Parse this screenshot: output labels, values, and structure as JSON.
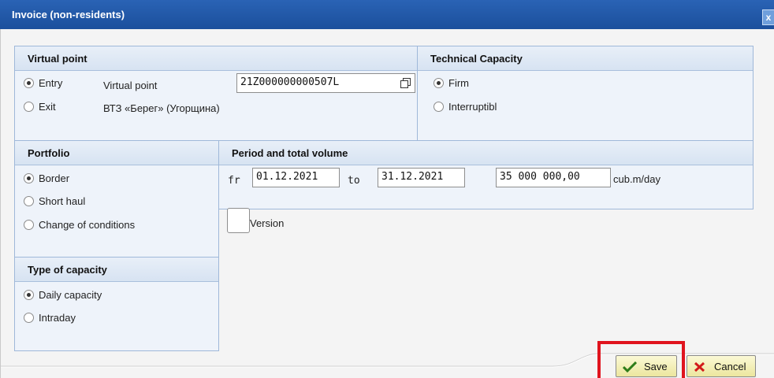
{
  "window": {
    "title": "Invoice (non-residents)",
    "close_glyph": "x"
  },
  "virtual_point": {
    "heading": "Virtual point",
    "options": [
      {
        "label": "Entry",
        "selected": true
      },
      {
        "label": "Exit",
        "selected": false
      }
    ],
    "field_label": "Virtual point",
    "field_value": "21Z000000000507L",
    "point_name": "ВТЗ «Берег» (Угорщина)"
  },
  "technical_capacity": {
    "heading": "Technical Capacity",
    "options": [
      {
        "label": "Firm",
        "selected": true
      },
      {
        "label": "Interruptibl",
        "selected": false
      }
    ]
  },
  "portfolio": {
    "heading": "Portfolio",
    "options": [
      {
        "label": "Border",
        "selected": true
      },
      {
        "label": "Short haul",
        "selected": false
      },
      {
        "label": "Change of conditions",
        "selected": false
      }
    ]
  },
  "capacity_type": {
    "heading": "Type of capacity",
    "options": [
      {
        "label": "Daily capacity",
        "selected": true
      },
      {
        "label": "Intraday",
        "selected": false
      }
    ]
  },
  "period": {
    "heading": "Period and total volume",
    "from_label": "fr",
    "from_value": "01.12.2021",
    "to_label": "to",
    "to_value": "31.12.2021",
    "volume_value": "35 000 000,00",
    "unit": "cub.m/day"
  },
  "version": {
    "label": "Version",
    "checked": false
  },
  "footer": {
    "save_label": "Save",
    "cancel_label": "Cancel"
  },
  "colors": {
    "title_bar": "#1b4f9c",
    "highlight": "#e0141e",
    "button": "#ece69e"
  },
  "icons": {
    "copy": "copy-icon",
    "save": "checkmark-icon",
    "cancel": "x-icon"
  }
}
